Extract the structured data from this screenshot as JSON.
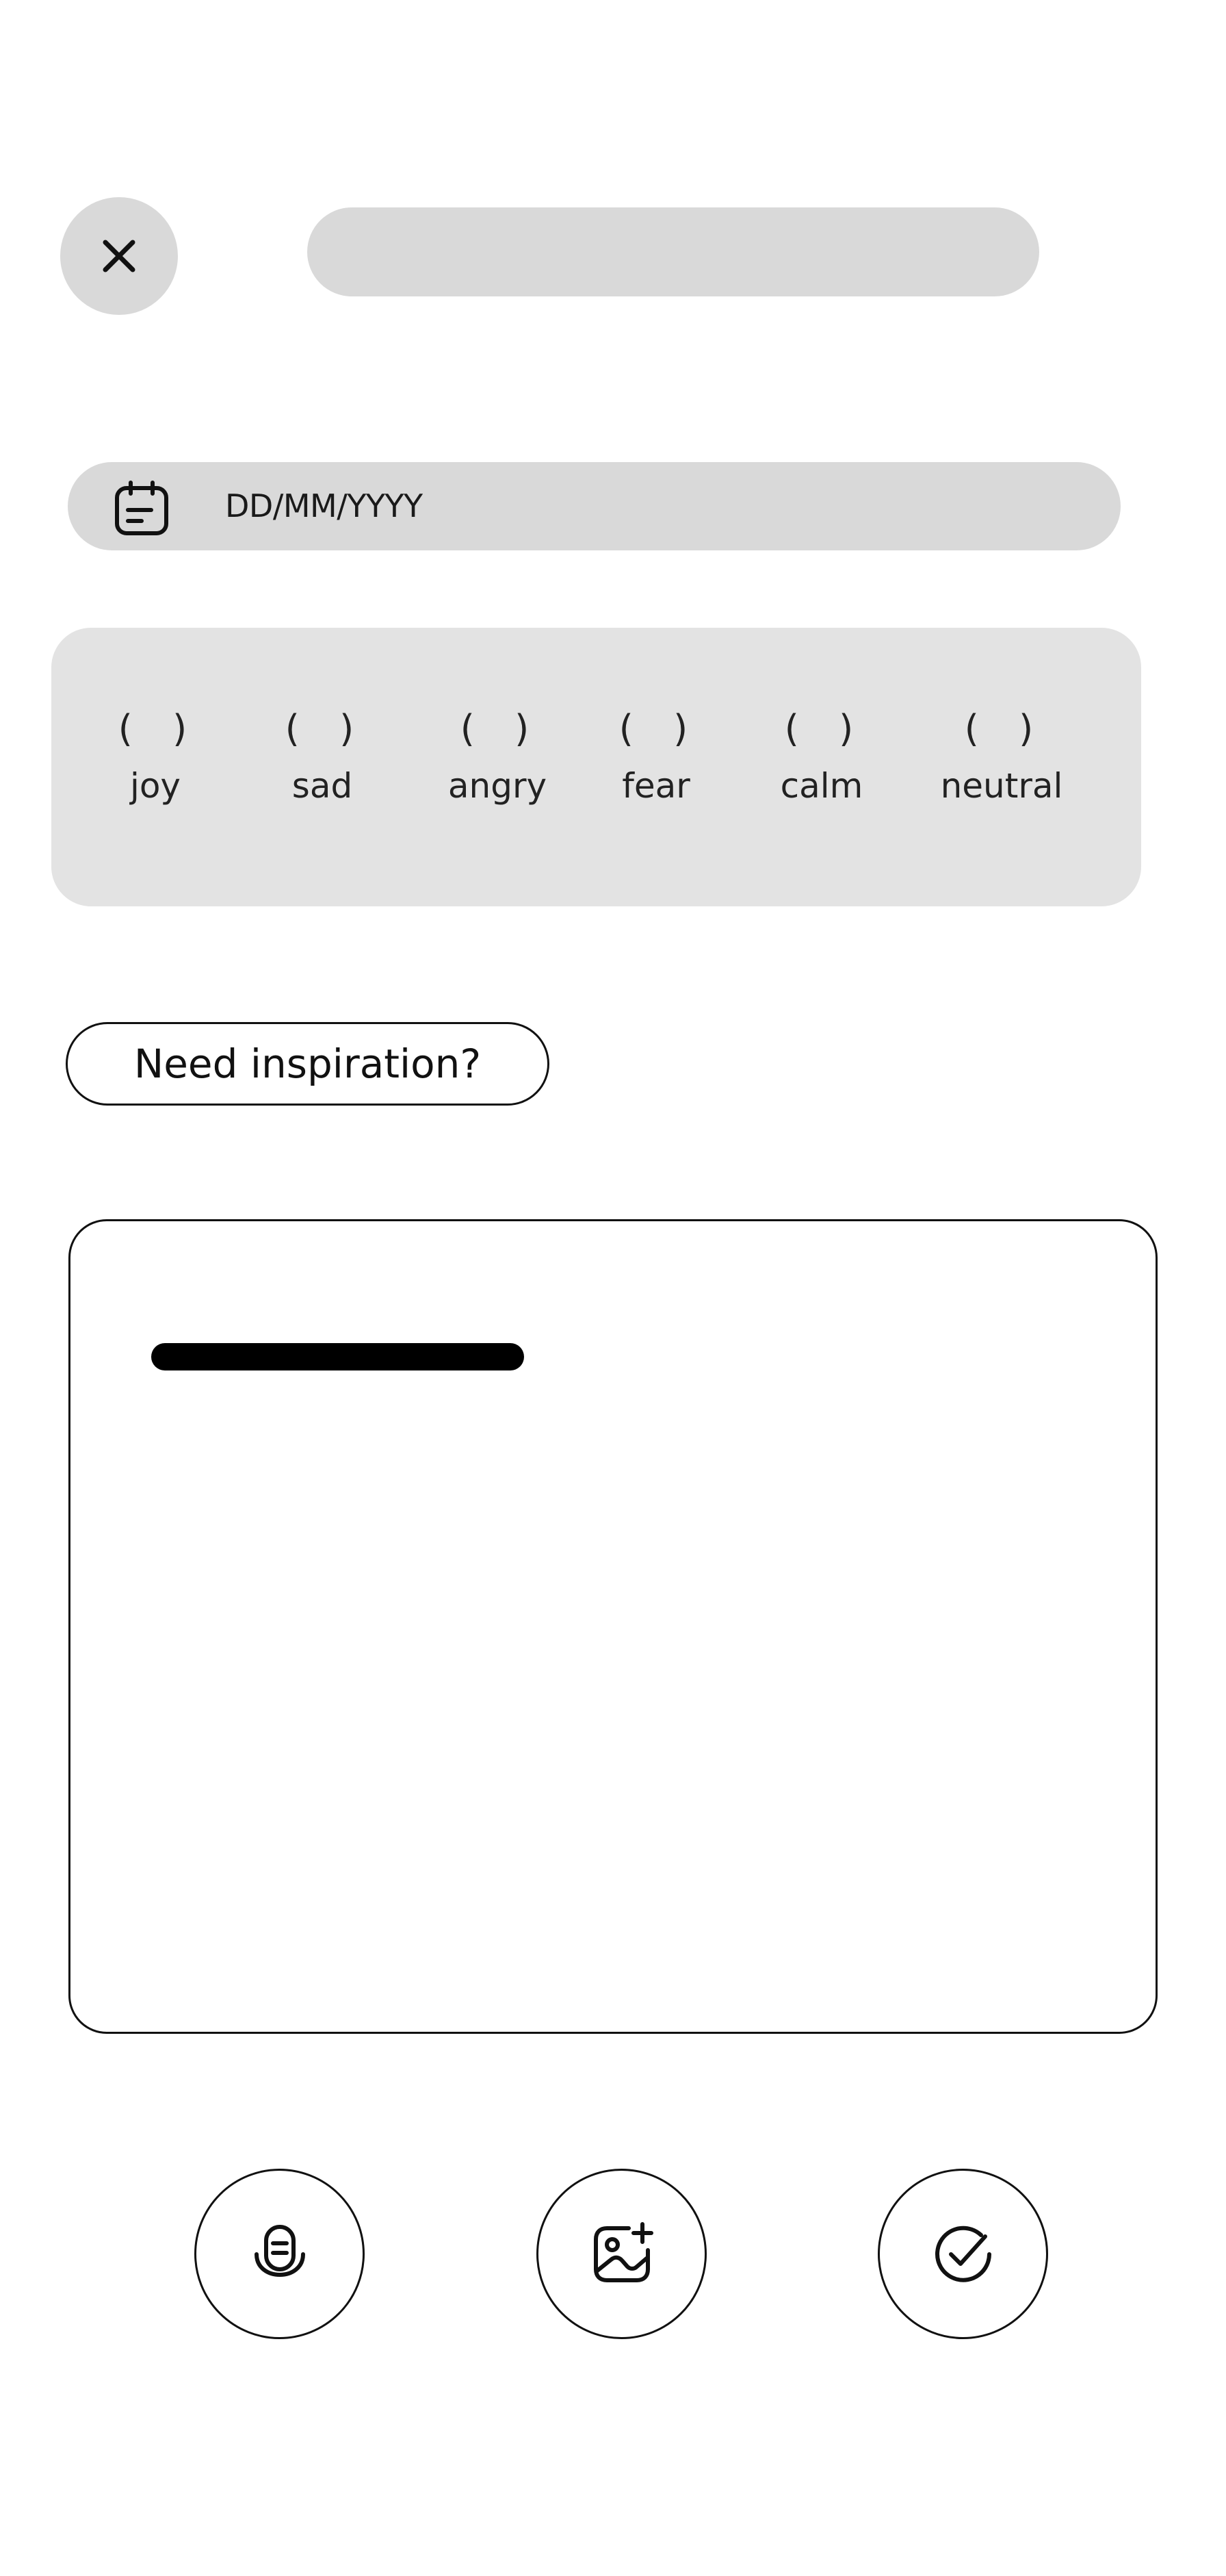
{
  "header": {
    "close_icon": "close-icon",
    "title_value": ""
  },
  "date": {
    "icon": "calendar-icon",
    "placeholder": "DD/MM/YYYY"
  },
  "moods": [
    {
      "marker": "(  )",
      "label": "joy"
    },
    {
      "marker": "(  )",
      "label": "sad"
    },
    {
      "marker": "(  )",
      "label": "angry"
    },
    {
      "marker": "(  )",
      "label": "fear"
    },
    {
      "marker": "(  )",
      "label": "calm"
    },
    {
      "marker": "(  )",
      "label": "neutral"
    }
  ],
  "inspiration_button": {
    "label": "Need inspiration?"
  },
  "journal": {
    "value": ""
  },
  "actions": [
    {
      "icon": "microphone-icon"
    },
    {
      "icon": "add-image-icon"
    },
    {
      "icon": "check-circle-icon"
    }
  ],
  "colors": {
    "placeholder_gray": "#d9d9d9",
    "panel_gray": "#e3e3e3",
    "ink": "#111111"
  }
}
